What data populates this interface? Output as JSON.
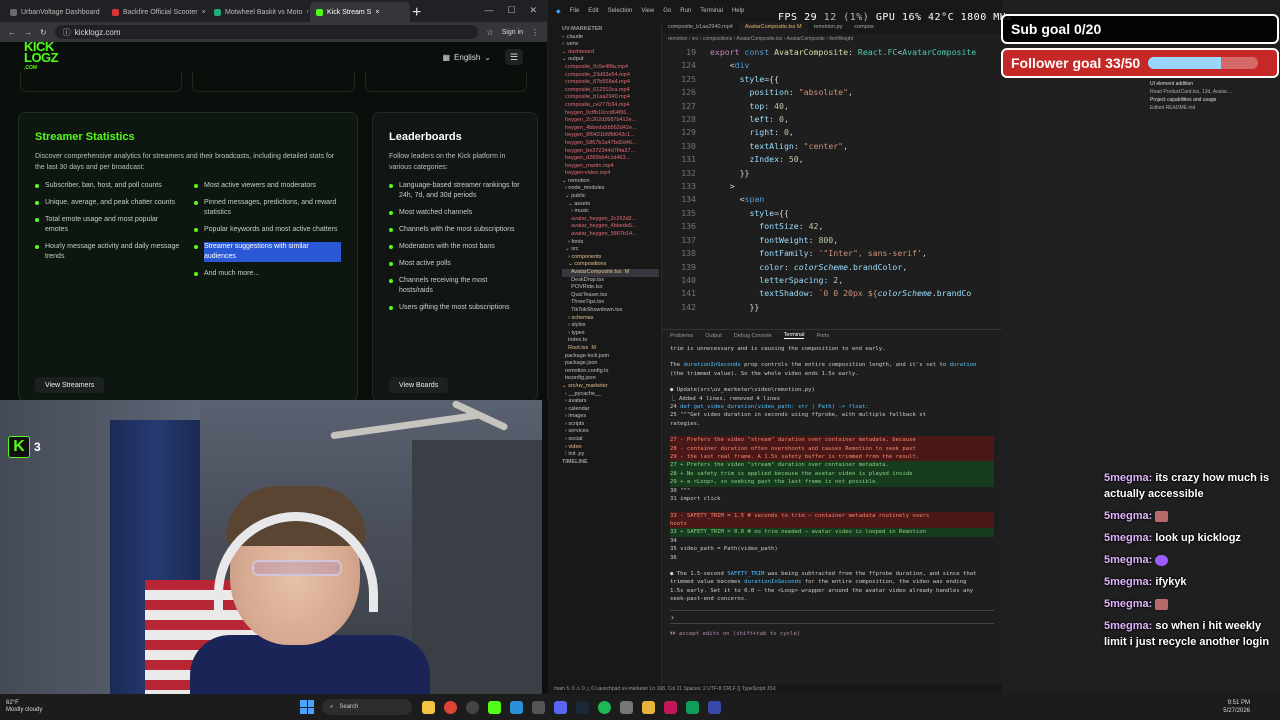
{
  "browser": {
    "tabs": [
      {
        "label": "UrbanVoltage Dashboard",
        "color": "#6b6b6b"
      },
      {
        "label": "Backfire Official Scooter",
        "color": "#d33"
      },
      {
        "label": "Motwheel Baskit vs Moto",
        "color": "#2a7"
      },
      {
        "label": "Kick Stream S",
        "color": "#53fc18"
      }
    ],
    "url": "kicklogz.com",
    "signin": "Sign in"
  },
  "site": {
    "logo_line1": "KICK",
    "logo_line2": "LOGZ",
    "logo_sub": ".COM",
    "language": "English",
    "stats": {
      "title": "Streamer Statistics",
      "desc": "Discover comprehensive analytics for streamers and their broadcasts, including detailed stats for the last 30 days and per broadcast:",
      "features_left": [
        "Subscriber, ban, host, and poll counts",
        "Unique, average, and peak chatter counts",
        "Total emote usage and most popular emotes",
        "Hourly message activity and daily message trends"
      ],
      "features_right": [
        "Most active viewers and moderators",
        "Pinned messages, predictions, and reward statistics",
        "Popular keywords and most active chatters",
        "Streamer suggestions with similar audiences"
      ],
      "more": "And much more...",
      "button": "View Streamers"
    },
    "boards": {
      "title": "Leaderboards",
      "desc": "Follow leaders on the Kick platform in various categories:",
      "items": [
        "Language-based streamer rankings for 24h, 7d, and 30d periods",
        "Most watched channels",
        "Channels with the most subscriptions",
        "Moderators with the most bans",
        "Most active polls",
        "Channels receiving the most hosts/raids",
        "Users gifting the most subscriptions"
      ],
      "button": "View Boards"
    }
  },
  "webcam": {
    "kick_count": "3"
  },
  "vscode": {
    "menu": [
      "File",
      "Edit",
      "Selection",
      "View",
      "Go",
      "Run",
      "Terminal",
      "Help"
    ],
    "explorer": [
      {
        "t": "UV-MARKETER",
        "c": "sect"
      },
      {
        "t": "› .claude",
        "c": ""
      },
      {
        "t": "› .venv",
        "c": ""
      },
      {
        "t": "⌄ dashboard",
        "c": "file"
      },
      {
        "t": "⌄ output",
        "c": ""
      },
      {
        "t": "  composite_0c5e4f8a.mp4",
        "c": "file"
      },
      {
        "t": "  composite_23d63e54.mp4",
        "c": "file"
      },
      {
        "t": "  composite_87b558a4.mp4",
        "c": "file"
      },
      {
        "t": "  composite_612910ca.mp4",
        "c": "file"
      },
      {
        "t": "  composite_b1aa2940.mp4",
        "c": "file"
      },
      {
        "t": "  composite_ce277b34.mp4",
        "c": "file"
      },
      {
        "t": "  heygen_0cffb10ccd64f96...",
        "c": "file"
      },
      {
        "t": "  heygen_2c262d2687b412e...",
        "c": "file"
      },
      {
        "t": "  heygen_4bbeda5b562d42e...",
        "c": "file"
      },
      {
        "t": "  heygen_8f0421b6ffd043c1...",
        "c": "file"
      },
      {
        "t": "  heygen_5867b1a47bd2d46...",
        "c": "file"
      },
      {
        "t": "  heygen_be372344d7f4a37...",
        "c": "file"
      },
      {
        "t": "  heygen_d285bb4c1d463...",
        "c": "file"
      },
      {
        "t": "  heygen_martin.mp4",
        "c": "file"
      },
      {
        "t": "  heygen-video.mp4",
        "c": "file"
      },
      {
        "t": "⌄ remotion",
        "c": ""
      },
      {
        "t": "  › node_modules",
        "c": ""
      },
      {
        "t": "  ⌄ public",
        "c": ""
      },
      {
        "t": "    ⌄ assets",
        "c": ""
      },
      {
        "t": "      › music",
        "c": ""
      },
      {
        "t": "      avatar_heygen_2c262d2...",
        "c": "file"
      },
      {
        "t": "      avatar_heygen_4bbeda5...",
        "c": "file"
      },
      {
        "t": "      avatar_heygen_5867b14...",
        "c": "file"
      },
      {
        "t": "    › fonts",
        "c": ""
      },
      {
        "t": "  ⌄ src",
        "c": ""
      },
      {
        "t": "    › components",
        "c": "mod"
      },
      {
        "t": "    ⌄ compositions",
        "c": "mod"
      },
      {
        "t": "      AvatarComposite.tsx  M",
        "c": "mod sel"
      },
      {
        "t": "      DeskDrop.tsx",
        "c": ""
      },
      {
        "t": "      POVRide.tsx",
        "c": ""
      },
      {
        "t": "      QuizTeaser.tsx",
        "c": ""
      },
      {
        "t": "      ThreeTips.tsx",
        "c": ""
      },
      {
        "t": "      TikTokShowdown.tsx",
        "c": ""
      },
      {
        "t": "    › schemas",
        "c": "mod"
      },
      {
        "t": "    › styles",
        "c": ""
      },
      {
        "t": "    › types",
        "c": ""
      },
      {
        "t": "    index.ts",
        "c": ""
      },
      {
        "t": "    Root.tsx  M",
        "c": "mod"
      },
      {
        "t": "  package-lock.json",
        "c": ""
      },
      {
        "t": "  package.json",
        "c": ""
      },
      {
        "t": "  remotion.config.ts",
        "c": ""
      },
      {
        "t": "  tsconfig.json",
        "c": ""
      },
      {
        "t": "⌄ src/uv_marketer",
        "c": "mod"
      },
      {
        "t": "  › __pycache__",
        "c": ""
      },
      {
        "t": "  › avatars",
        "c": ""
      },
      {
        "t": "  › calendar",
        "c": ""
      },
      {
        "t": "  › images",
        "c": ""
      },
      {
        "t": "  › scripts",
        "c": ""
      },
      {
        "t": "  › services",
        "c": ""
      },
      {
        "t": "  › social",
        "c": ""
      },
      {
        "t": "  › video",
        "c": "mod"
      },
      {
        "t": "  ⁝ init .py",
        "c": ""
      },
      {
        "t": "TIMELINE",
        "c": "sect"
      }
    ],
    "tabs": [
      {
        "label": "composite_b1aa2940.mp4",
        "on": false
      },
      {
        "label": "AvatarComposite.tsx M",
        "on": true
      },
      {
        "label": "remotion.py",
        "on": false
      },
      {
        "label": "compos",
        "on": false
      }
    ],
    "breadcrumb": "remotion › src › compositions › AvatarComposite.tsx › AvatarComposite › fontWeight",
    "panel_tabs": [
      "Problems",
      "Output",
      "Debug Console",
      "Terminal",
      "Ports"
    ],
    "status": "main ↻ 0 ⚠ 0 △ 0   Launchpad   uv-marketer          Ln 168, Col 21  Spaces: 2  UTF-8  CRLF  {} TypeScript JSX"
  },
  "overlays": {
    "fps_label": "FPS",
    "fps_value": "29",
    "fps_drop": "12 (1%)",
    "gpu": "GPU 16% 42°C 1800 MHz",
    "sub_goal": "Sub goal 0/20",
    "follower_goal": "Follower goal 33/50",
    "follower_progress": 0.66,
    "side_panel": [
      "UI element addition",
      "Read ProductCard.tsx, 13d, Avatar…",
      "Project capabilities and usage",
      "Edited README.md"
    ]
  },
  "chat": [
    {
      "user": "5megma:",
      "text": "its crazy how much is actually accessible",
      "emote": ""
    },
    {
      "user": "5megma:",
      "text": "",
      "emote": "brown"
    },
    {
      "user": "5megma:",
      "text": "look up kicklogz",
      "emote": ""
    },
    {
      "user": "5megma:",
      "text": "",
      "emote": "purple"
    },
    {
      "user": "5megma:",
      "text": "ifykyk",
      "emote": ""
    },
    {
      "user": "5megma:",
      "text": "",
      "emote": "brown"
    },
    {
      "user": "5megma:",
      "text": "so when i hit weekly limit i just recycle another login",
      "emote": ""
    }
  ],
  "taskbar": {
    "weather": "62°F",
    "weather_desc": "Mostly cloudy",
    "search": "Search",
    "time": "9:51 PM",
    "date": "5/27/2026"
  }
}
